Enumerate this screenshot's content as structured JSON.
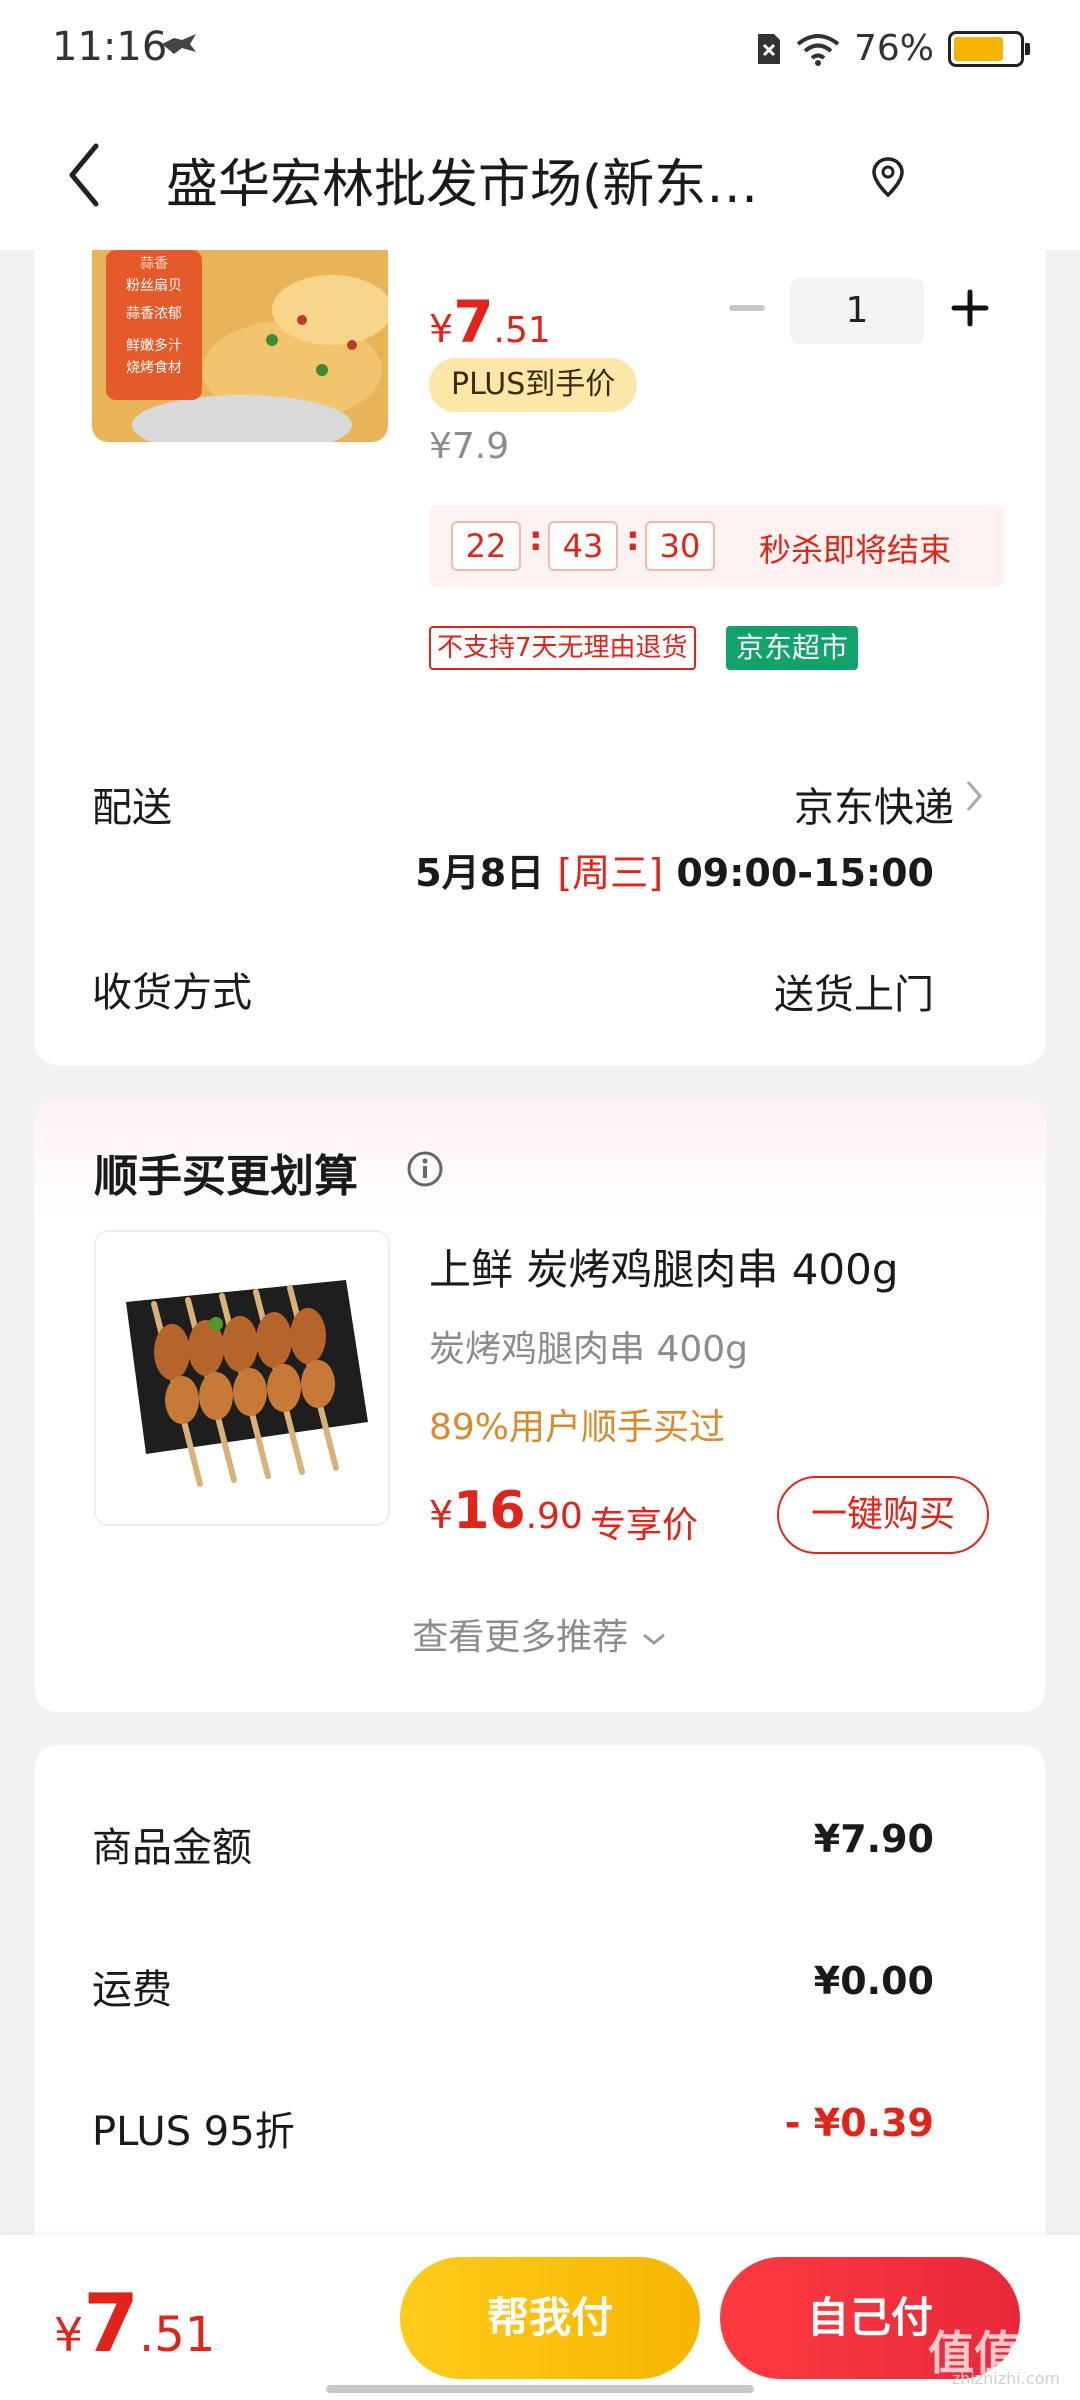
{
  "status_bar": {
    "time": "11:16",
    "battery": "76%",
    "battery_level": 0.76
  },
  "nav": {
    "title": "盛华宏林批发市场(新东…"
  },
  "product": {
    "image_lines": [
      "蒜香",
      "粉丝扇贝",
      "蒜香浓郁",
      "鲜嫩多汁",
      "烧烤食材"
    ],
    "price": {
      "currency": "¥",
      "int": "7",
      "dec": ".51"
    },
    "quantity": "1",
    "plus_badge": "PLUS到手价",
    "original_price": "¥7.9",
    "countdown": {
      "hours": "22",
      "minutes": "43",
      "seconds": "30",
      "label": "秒杀即将结束"
    },
    "tags": {
      "no_return": "不支持7天无理由退货",
      "store": "京东超市"
    }
  },
  "delivery": {
    "label": "配送",
    "value": "京东快递",
    "date": "5月8日",
    "weekday": "[周三]",
    "time_range": "09:00-15:00",
    "receive_label": "收货方式",
    "receive_value": "送货上门"
  },
  "recommend": {
    "title": "顺手买更划算",
    "item": {
      "name": "上鲜 炭烤鸡腿肉串 400g",
      "subtitle": "炭烤鸡腿肉串 400g",
      "social": "89%用户顺手买过",
      "price": {
        "currency": "¥",
        "int": "16",
        "dec": ".90"
      },
      "price_tag": "专享价",
      "buy_label": "一键购买"
    },
    "more_label": "查看更多推荐"
  },
  "summary": {
    "rows": [
      {
        "label": "商品金额",
        "value": "¥7.90"
      },
      {
        "label": "运费",
        "value": "¥0.00"
      },
      {
        "label": "PLUS 95折",
        "value": "- ¥0.39"
      }
    ]
  },
  "bottom": {
    "total": {
      "currency": "¥",
      "int": "7",
      "dec": ".51"
    },
    "help_pay": "帮我付",
    "self_pay": "自己付",
    "watermark": "值值值",
    "watermark_url": "zhizhizhi.com"
  },
  "colors": {
    "accent_red": "#e2231a",
    "plus_gold": "#fce6a8",
    "jd_green": "#11a36a",
    "pay_yellow": "#f7b500"
  }
}
